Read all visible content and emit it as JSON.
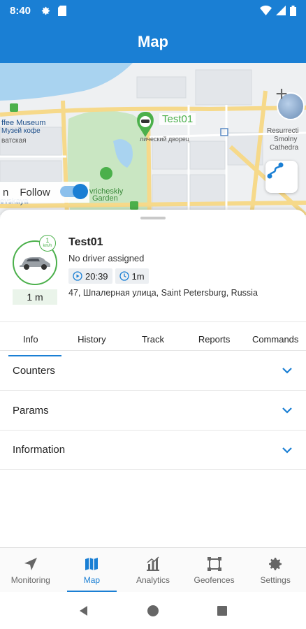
{
  "status_bar": {
    "time": "8:40",
    "icons": [
      "gear-icon",
      "sd-card-icon",
      "wifi-icon",
      "signal-icon",
      "battery-icon"
    ]
  },
  "app_bar": {
    "title": "Map"
  },
  "map": {
    "labels": {
      "museum": "ffee Museum",
      "museum_ru": "Музей кофе",
      "street_ru": "ватская",
      "garden": "vricheskiy",
      "garden2": "Garden",
      "vskaya": "evskaya",
      "cathedral1": "Resurrecti",
      "cathedral2": "Smolny",
      "cathedral3": "Cathedra",
      "palace_ru": "лический дворец"
    },
    "marker_label": "Test01",
    "follow": {
      "label": "Follow",
      "enabled": true,
      "prefix": "n"
    }
  },
  "unit": {
    "name": "Test01",
    "driver": "No driver assigned",
    "speed_value": "1",
    "speed_unit": "km/h",
    "age": "1 m",
    "time": "20:39",
    "duration": "1m",
    "address": "47, Шпалерная улица, Saint Petersburg, Russia"
  },
  "tabs": [
    {
      "label": "Info",
      "active": true
    },
    {
      "label": "History",
      "active": false
    },
    {
      "label": "Track",
      "active": false
    },
    {
      "label": "Reports",
      "active": false
    },
    {
      "label": "Commands",
      "active": false
    }
  ],
  "sections": [
    "Counters",
    "Params",
    "Information"
  ],
  "bottom_nav": [
    {
      "label": "Monitoring",
      "icon": "navigation-arrow-icon",
      "active": false
    },
    {
      "label": "Map",
      "icon": "map-icon",
      "active": true
    },
    {
      "label": "Analytics",
      "icon": "analytics-icon",
      "active": false
    },
    {
      "label": "Geofences",
      "icon": "geofence-icon",
      "active": false
    },
    {
      "label": "Settings",
      "icon": "gear-icon",
      "active": false
    }
  ],
  "colors": {
    "primary": "#1a7fd4",
    "online": "#4bb04b"
  }
}
